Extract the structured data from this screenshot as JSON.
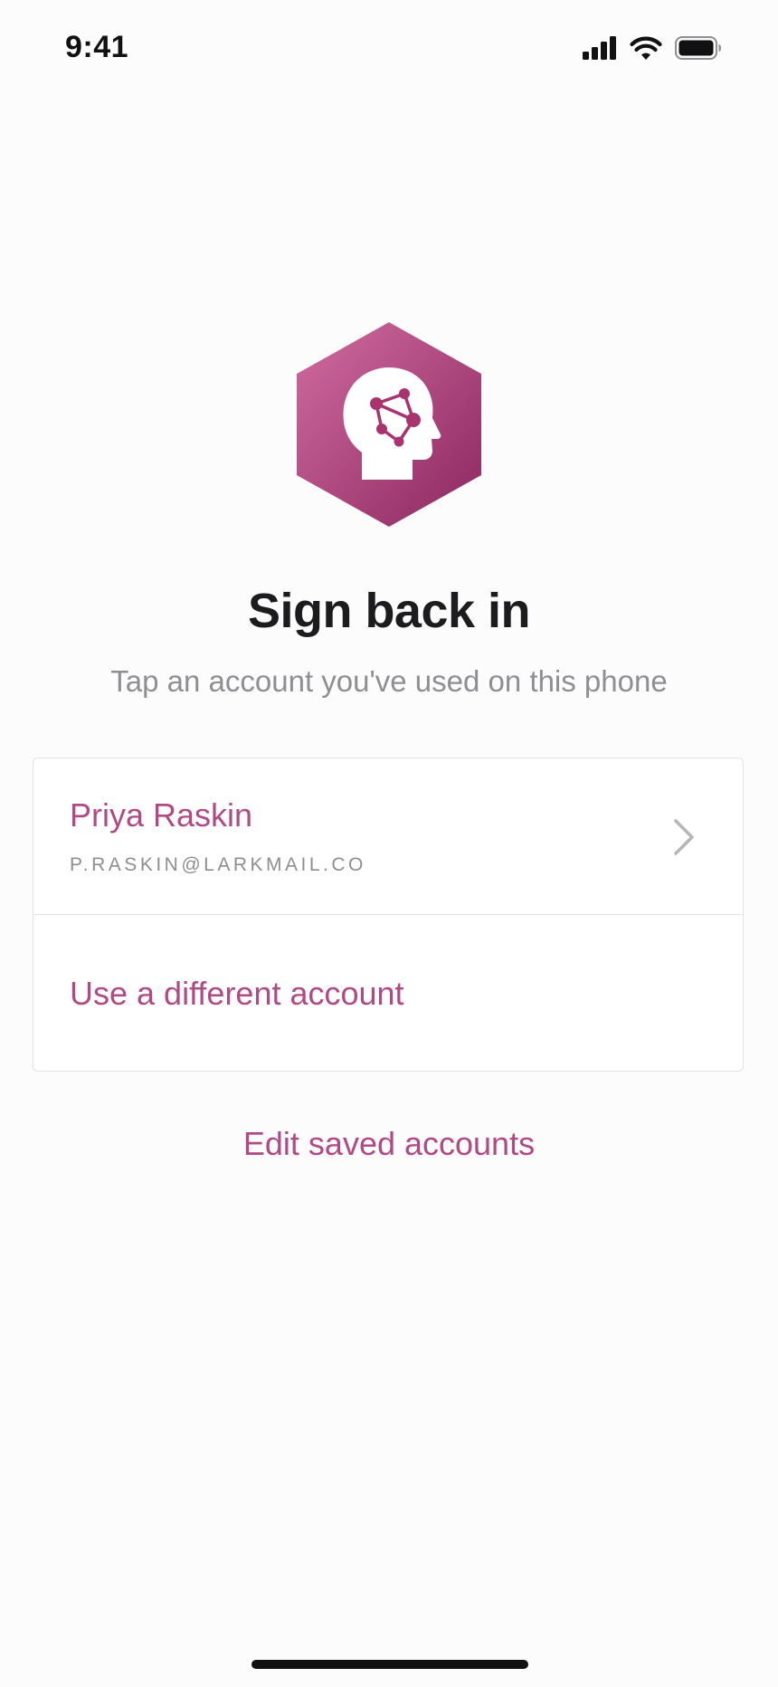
{
  "status_bar": {
    "time": "9:41",
    "icons": [
      "cellular-signal-icon",
      "wifi-icon",
      "battery-icon"
    ]
  },
  "logo": {
    "icon": "brain-network-head-icon",
    "gradient_start": "#cf6a9e",
    "gradient_end": "#8e2a62"
  },
  "title": "Sign back in",
  "subtitle": "Tap an account you've used on this phone",
  "accounts": {
    "saved": {
      "name": "Priya Raskin",
      "email": "P.RASKIN@LARKMAIL.CO"
    },
    "different_account_label": "Use a different account"
  },
  "edit_saved_label": "Edit saved accounts",
  "colors": {
    "accent": "#b04a84",
    "secondary_text": "#8e8e93",
    "background": "#fcfcfc"
  }
}
